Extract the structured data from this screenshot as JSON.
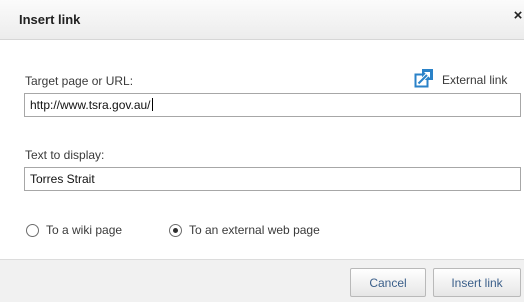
{
  "dialog": {
    "title": "Insert link",
    "close_glyph": "×"
  },
  "url": {
    "label": "Target page or URL:",
    "value": "http://www.tsra.gov.au/",
    "external_link_label": "External link",
    "external_link_icon": "external-link-icon"
  },
  "text": {
    "label": "Text to display:",
    "value": "Torres Strait"
  },
  "link_type": {
    "options": [
      {
        "label": "To a wiki page",
        "selected": false
      },
      {
        "label": "To an external web page",
        "selected": true
      }
    ]
  },
  "buttons": {
    "cancel": "Cancel",
    "insert": "Insert link"
  },
  "colors": {
    "accent": "#3b5f8a",
    "icon_blue": "#2a82c8"
  }
}
